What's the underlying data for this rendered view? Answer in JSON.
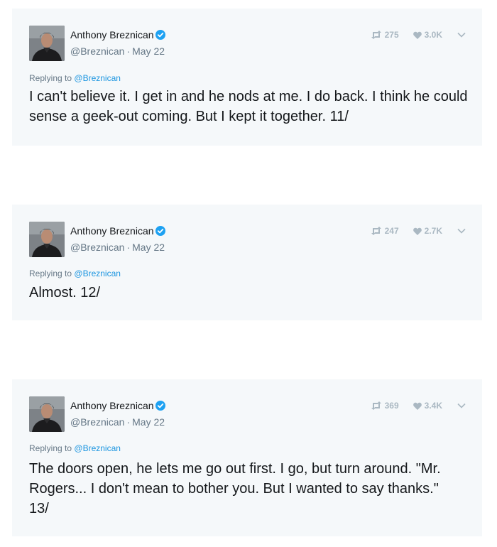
{
  "tweets": [
    {
      "name": "Anthony Breznican",
      "handle": "@Breznican",
      "separator": "·",
      "date": "May 22",
      "retweets": "275",
      "likes": "3.0K",
      "replying_prefix": "Replying to",
      "replying_to": "@Breznican",
      "text": "I can't believe it. I get in and he nods at me. I do back. I think he could sense a geek-out coming. But I kept it together. 11/"
    },
    {
      "name": "Anthony Breznican",
      "handle": "@Breznican",
      "separator": "·",
      "date": "May 22",
      "retweets": "247",
      "likes": "2.7K",
      "replying_prefix": "Replying to",
      "replying_to": "@Breznican",
      "text": "Almost. 12/"
    },
    {
      "name": "Anthony Breznican",
      "handle": "@Breznican",
      "separator": "·",
      "date": "May 22",
      "retweets": "369",
      "likes": "3.4K",
      "replying_prefix": "Replying to",
      "replying_to": "@Breznican",
      "text": "The doors open, he lets me go out first. I go, but turn around. \"Mr. Rogers... I don't mean to bother you. But I wanted to say thanks.\" 13/"
    }
  ],
  "icons": {
    "verified": "verified-badge-icon",
    "retweet": "retweet-icon",
    "like": "heart-icon",
    "caret": "chevron-down-icon"
  },
  "colors": {
    "card_bg": "#f5f8fa",
    "verified": "#1da1f2",
    "link": "#1b95e0",
    "muted": "#657786",
    "stat": "#aab8c2"
  }
}
